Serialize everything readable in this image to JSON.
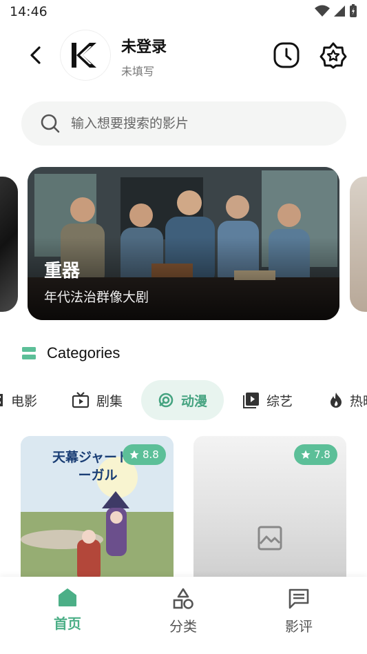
{
  "status_bar": {
    "time": "14:46"
  },
  "header": {
    "user_name": "未登录",
    "user_sub": "未填写",
    "icons": {
      "back": "back-arrow-icon",
      "avatar": "k-logo",
      "history": "clock-icon",
      "favorite": "star-badge-icon"
    }
  },
  "search": {
    "placeholder": "输入想要搜索的影片",
    "icon": "search-icon"
  },
  "carousel": {
    "slides": [
      {
        "title": "重器",
        "subtitle": "年代法治群像大剧"
      }
    ]
  },
  "categories": {
    "title": "Categories",
    "tabs": [
      {
        "label": "电影",
        "icon": "film-icon"
      },
      {
        "label": "剧集",
        "icon": "tv-icon"
      },
      {
        "label": "动漫",
        "icon": "anime-icon",
        "active": true
      },
      {
        "label": "综艺",
        "icon": "play-square-icon"
      },
      {
        "label": "热映",
        "icon": "flame-icon"
      }
    ]
  },
  "cards": [
    {
      "rating": "8.8",
      "poster_title": "天幕ジャードゥーガル"
    },
    {
      "rating": "7.8"
    }
  ],
  "bottom_nav": [
    {
      "label": "首页",
      "icon": "home-icon",
      "active": true
    },
    {
      "label": "分类",
      "icon": "shapes-icon"
    },
    {
      "label": "影评",
      "icon": "message-icon"
    }
  ],
  "colors": {
    "accent": "#4caf87",
    "accent_bg": "#e8f4ef",
    "rating_bg": "#5cbf98"
  }
}
